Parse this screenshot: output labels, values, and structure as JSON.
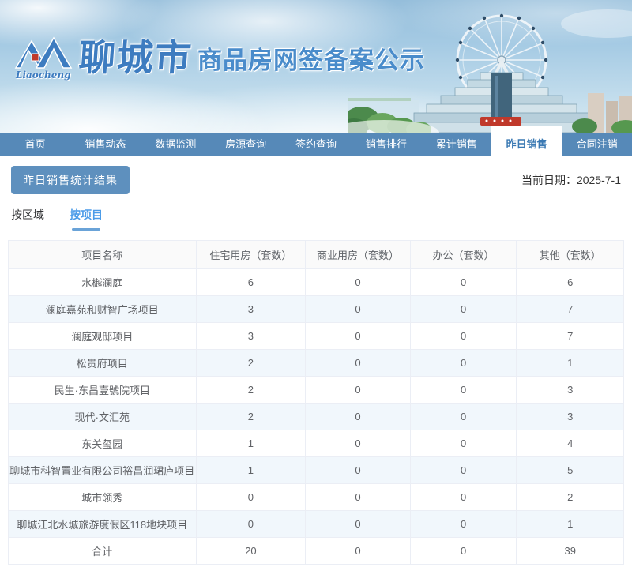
{
  "header": {
    "logo_script": "Liaocheng",
    "city_title": "聊城市",
    "site_title": "商品房网签备案公示"
  },
  "nav": {
    "items": [
      {
        "label": "首页",
        "active": false
      },
      {
        "label": "销售动态",
        "active": false
      },
      {
        "label": "数据监测",
        "active": false
      },
      {
        "label": "房源查询",
        "active": false
      },
      {
        "label": "签约查询",
        "active": false
      },
      {
        "label": "销售排行",
        "active": false
      },
      {
        "label": "累计销售",
        "active": false
      },
      {
        "label": "昨日销售",
        "active": true
      },
      {
        "label": "合同注销",
        "active": false
      }
    ]
  },
  "main": {
    "section_title": "昨日销售统计结果",
    "date_label": "当前日期：",
    "date_value": "2025-7-1",
    "tabs": [
      {
        "label": "按区域",
        "active": false
      },
      {
        "label": "按项目",
        "active": true
      }
    ]
  },
  "table": {
    "columns": [
      "项目名称",
      "住宅用房（套数）",
      "商业用房（套数）",
      "办公（套数）",
      "其他（套数）"
    ],
    "rows": [
      [
        "水樾澜庭",
        "6",
        "0",
        "0",
        "6"
      ],
      [
        "澜庭嘉苑和财智广场项目",
        "3",
        "0",
        "0",
        "7"
      ],
      [
        "澜庭观邸项目",
        "3",
        "0",
        "0",
        "7"
      ],
      [
        "松贵府项目",
        "2",
        "0",
        "0",
        "1"
      ],
      [
        "民生·东昌壹號院项目",
        "2",
        "0",
        "0",
        "3"
      ],
      [
        "现代·文汇苑",
        "2",
        "0",
        "0",
        "3"
      ],
      [
        "东关玺园",
        "1",
        "0",
        "0",
        "4"
      ],
      [
        "聊城市科智置业有限公司裕昌润珺庐项目",
        "1",
        "0",
        "0",
        "5"
      ],
      [
        "城市领秀",
        "0",
        "0",
        "0",
        "2"
      ],
      [
        "聊城江北水城旅游度假区118地块项目",
        "0",
        "0",
        "0",
        "1"
      ],
      [
        "合计",
        "20",
        "0",
        "0",
        "39"
      ]
    ]
  },
  "colors": {
    "nav_blue": "#5689b8",
    "badge_blue": "#5e90be",
    "active_tab_text": "#4a9be8",
    "table_border": "#ebeef5",
    "stripe_row": "#f1f7fc",
    "title_blue": "#4a8ccb"
  }
}
